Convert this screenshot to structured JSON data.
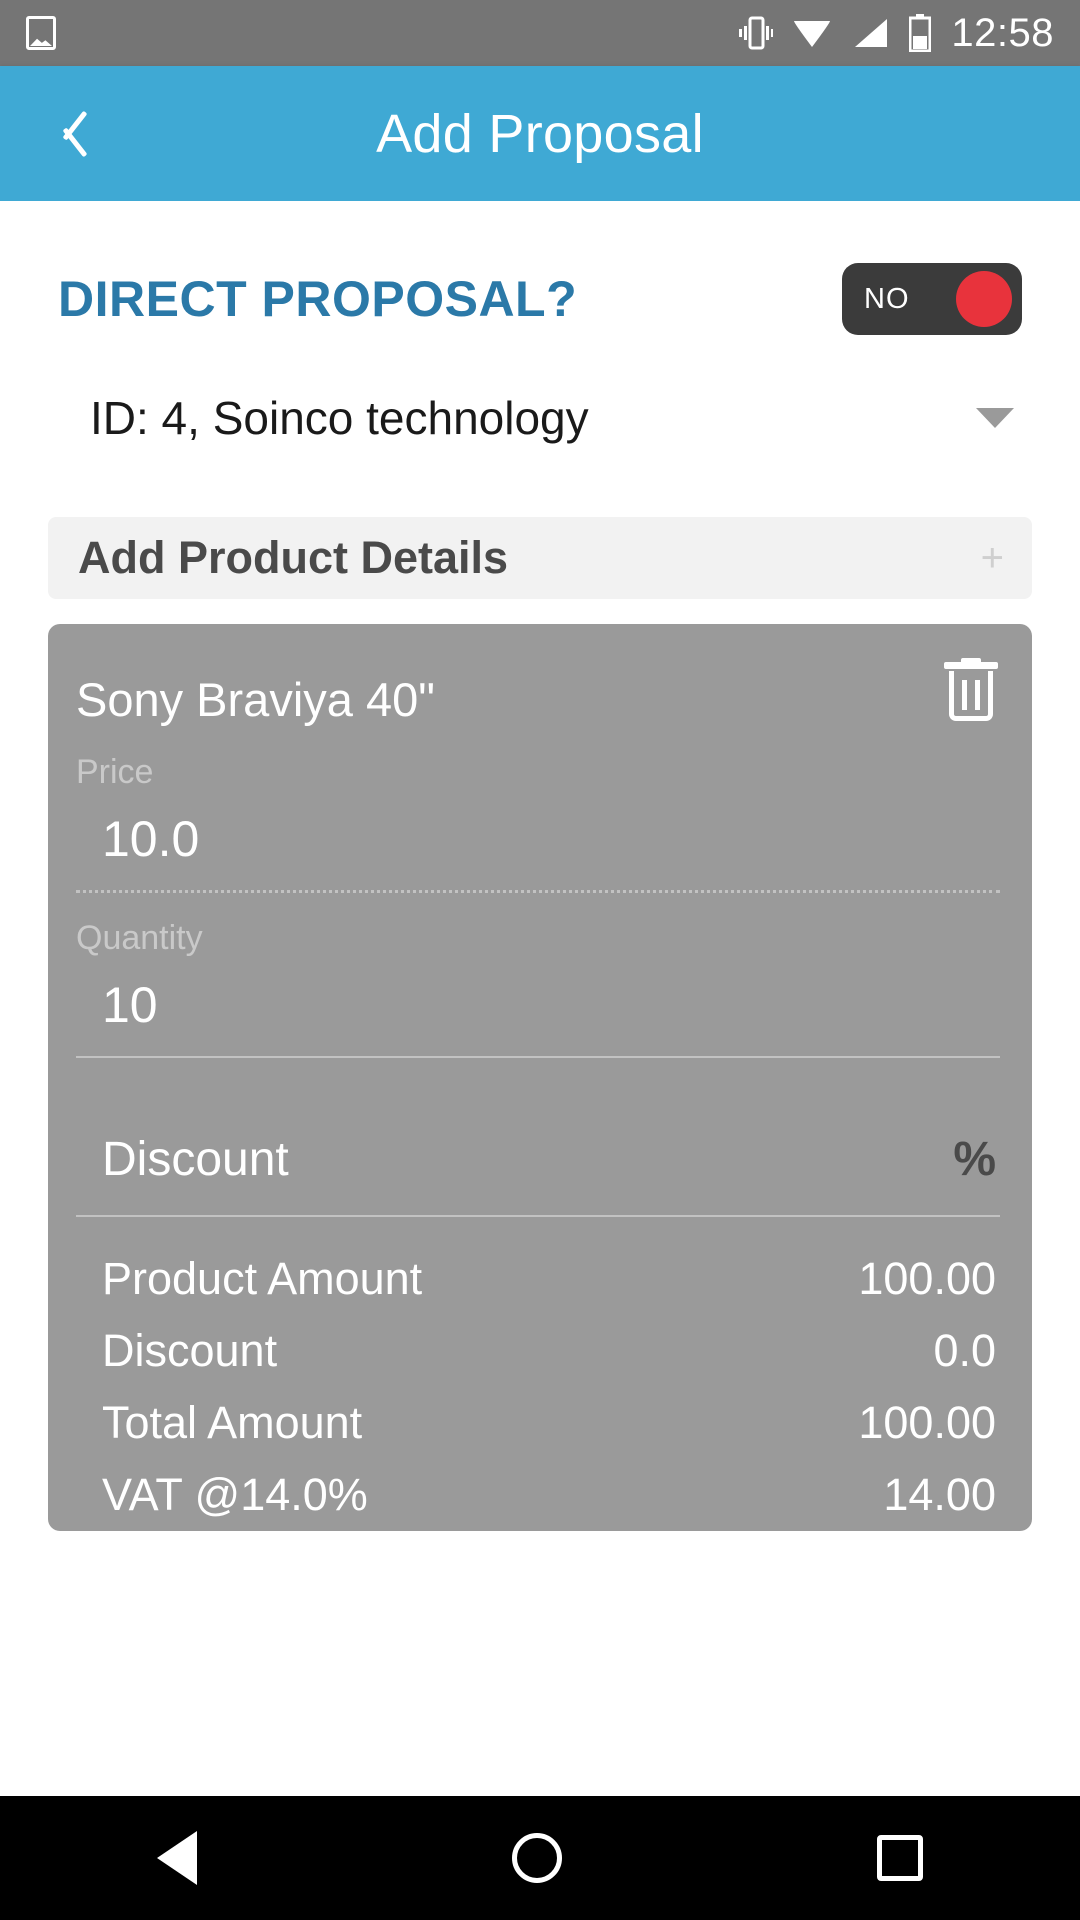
{
  "statusbar": {
    "time": "12:58",
    "icons": [
      "photo-icon",
      "vibrate-icon",
      "wifi-icon",
      "signal-icon",
      "battery-icon"
    ]
  },
  "appbar": {
    "title": "Add Proposal",
    "back_icon": "back-chevron-icon"
  },
  "form": {
    "direct_proposal_label": "DIRECT PROPOSAL?",
    "direct_proposal_toggle": {
      "state_label": "NO",
      "knob_color": "#E8333C",
      "track_color": "#3B3B3B"
    },
    "customer_dropdown": {
      "value": "ID: 4, Soinco technology",
      "arrow_icon": "chevron-down-icon"
    },
    "add_product_details": {
      "label": "Add Product Details",
      "plus_icon": "plus-icon"
    }
  },
  "product_card": {
    "title": "Sony Braviya 40\"",
    "delete_icon": "trash-icon",
    "price": {
      "label": "Price",
      "value": "10.0"
    },
    "quantity": {
      "label": "Quantity",
      "value": "10"
    },
    "discount": {
      "label": "Discount",
      "unit": "%"
    },
    "summary": [
      {
        "label": "Product Amount",
        "value": "100.00"
      },
      {
        "label": "Discount",
        "value": "0.0"
      },
      {
        "label": "Total Amount",
        "value": "100.00"
      },
      {
        "label": "VAT @14.0%",
        "value": "14.00"
      }
    ]
  },
  "navbar": {
    "back_icon": "nav-back-icon",
    "home_icon": "nav-home-icon",
    "recents_icon": "nav-recents-icon"
  },
  "colors": {
    "accent": "#3FA9D4",
    "heading": "#2B79A8",
    "card_bg": "#9A9A9A",
    "statusbar_bg": "#757575",
    "toggle_knob": "#E8333C"
  }
}
